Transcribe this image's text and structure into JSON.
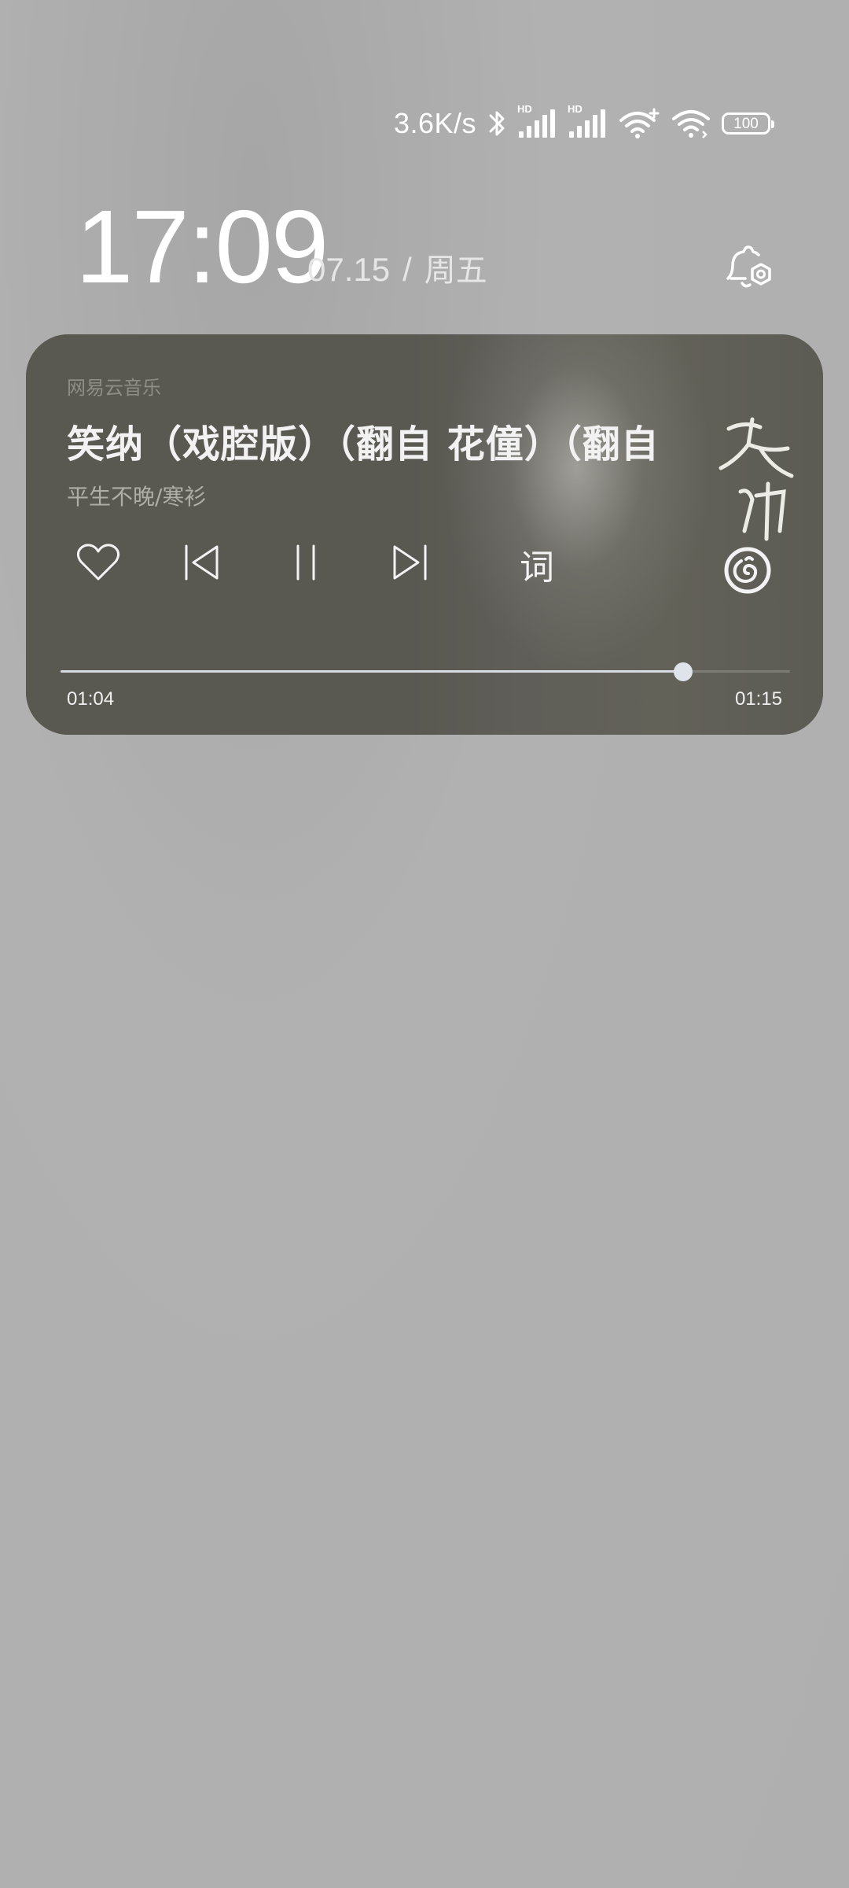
{
  "status_bar": {
    "net_speed": "3.6K/s",
    "sim1_badge": "HD",
    "sim2_badge": "HD",
    "battery_level": "100"
  },
  "lockscreen": {
    "time": "17:09",
    "date": "07.15",
    "separator": "/",
    "weekday": "周五"
  },
  "music_card": {
    "app_name": "网易云音乐",
    "title": "笑纳（戏腔版）（翻自 花僮）（翻自",
    "artist": "平生不晚/寒衫",
    "lyric_label": "词",
    "current_time": "01:04",
    "total_time": "01:15",
    "progress": 0.853,
    "liked": false,
    "playing": true
  }
}
